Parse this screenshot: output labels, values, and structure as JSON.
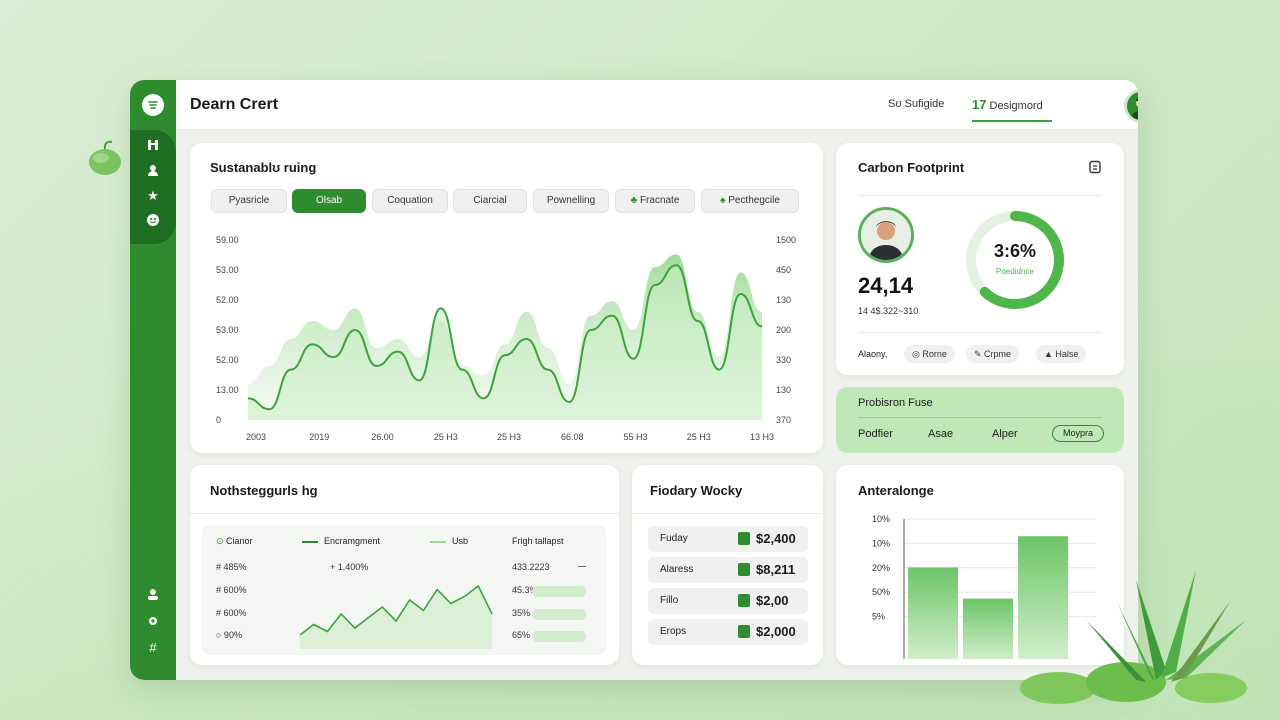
{
  "header": {
    "app_title": "Dearn Crert",
    "link_1": "Sʊ Sufigide",
    "link_2_num": "17",
    "link_2_label": "Desigmord"
  },
  "sidebar": {
    "icons": [
      "menu-icon",
      "dashboard-icon",
      "users-icon",
      "star-icon",
      "smile-icon",
      "user-bottom-icon",
      "settings-icon",
      "grid-icon"
    ]
  },
  "sustainability": {
    "title": "Sustanablʊ ruing",
    "tabs": [
      "Pyasricle",
      "Olsab",
      "Coquation",
      "Ciarcial",
      "Pownelling",
      "Fracnate",
      "Pecthegcile"
    ],
    "active_tab": 1,
    "y_left": [
      "59.00",
      "53.00",
      "52.00",
      "53.00",
      "52.00",
      "13.00",
      "0"
    ],
    "y_right": [
      "1500",
      "450",
      "130",
      "200",
      "330",
      "130",
      "370"
    ],
    "x_labels": [
      "2003",
      "2019",
      "26.00",
      "25 H3",
      "25 H3",
      "66.08",
      "55 H3",
      "25 H3",
      "13 H3"
    ]
  },
  "carbon": {
    "title": "Carbon Footprint",
    "big_value": "24,14",
    "sub_value": "14 4$.322~310",
    "ring_value": "3:6%",
    "ring_label": "Poedidnce",
    "ring_fraction": 0.62,
    "footer_label": "Alaony,",
    "pills": [
      "Rorne",
      "Crpme",
      "Halse"
    ]
  },
  "promo": {
    "title": "Probisron Fuse",
    "items": [
      "Podfier",
      "Asae",
      "Alper"
    ],
    "button": "Moypra"
  },
  "notes": {
    "title": "Nothsteggurls hg",
    "legend": [
      "Cianor",
      "Encramgment",
      "Usb"
    ],
    "col_header": "Frigh tallapst",
    "rows": [
      {
        "left": "# 485%",
        "right": "433.2223"
      },
      {
        "left": "# 600%",
        "right": "45.3%"
      },
      {
        "left": "# 600%",
        "right": "35%"
      },
      {
        "left": "○ 90%",
        "right": "65%"
      }
    ],
    "mid_value": "+ 1.400%"
  },
  "weekly": {
    "title": "Fiodary Wocky",
    "rows": [
      {
        "label": "Fuday",
        "value": "$2,400"
      },
      {
        "label": "Alaress",
        "value": "$8,211"
      },
      {
        "label": "Fillo",
        "value": "$2,00"
      },
      {
        "label": "Erops",
        "value": "$2,000"
      }
    ]
  },
  "anteralonge": {
    "title": "Anteralonge",
    "y_labels": [
      "10%",
      "10%",
      "20%",
      "50%",
      "5%"
    ]
  },
  "chart_data": [
    {
      "type": "area",
      "title": "Sustanablʊ ruing",
      "x": [
        "2003",
        "2019",
        "26.00",
        "25 H3",
        "25 H3",
        "66.08",
        "55 H3",
        "25 H3",
        "13 H3"
      ],
      "y_left_ticks": [
        "59.00",
        "53.00",
        "52.00",
        "53.00",
        "52.00",
        "13.00",
        "0"
      ],
      "y_right_ticks": [
        "1500",
        "450",
        "130",
        "200",
        "330",
        "130",
        "370"
      ],
      "series": [
        {
          "values": [
            0.12,
            0.06,
            0.28,
            0.42,
            0.35,
            0.5,
            0.3,
            0.38,
            0.22,
            0.62,
            0.28,
            0.12,
            0.36,
            0.45,
            0.28,
            0.1,
            0.5,
            0.58,
            0.34,
            0.75,
            0.86,
            0.55,
            0.28,
            0.7,
            0.52
          ]
        },
        {
          "values": [
            0.2,
            0.3,
            0.45,
            0.55,
            0.5,
            0.62,
            0.4,
            0.45,
            0.35,
            0.55,
            0.3,
            0.25,
            0.42,
            0.6,
            0.4,
            0.2,
            0.58,
            0.66,
            0.5,
            0.85,
            0.92,
            0.6,
            0.35,
            0.82,
            0.6
          ]
        }
      ]
    },
    {
      "type": "bar",
      "title": "Anteralonge",
      "y_ticks": [
        "10%",
        "10%",
        "20%",
        "50%",
        "5%"
      ],
      "values": [
        0.72,
        0.48,
        0.96
      ]
    },
    {
      "type": "line",
      "values": [
        0.2,
        0.35,
        0.25,
        0.5,
        0.3,
        0.45,
        0.6,
        0.4,
        0.7,
        0.55,
        0.85,
        0.65,
        0.75,
        0.9,
        0.5
      ]
    }
  ]
}
